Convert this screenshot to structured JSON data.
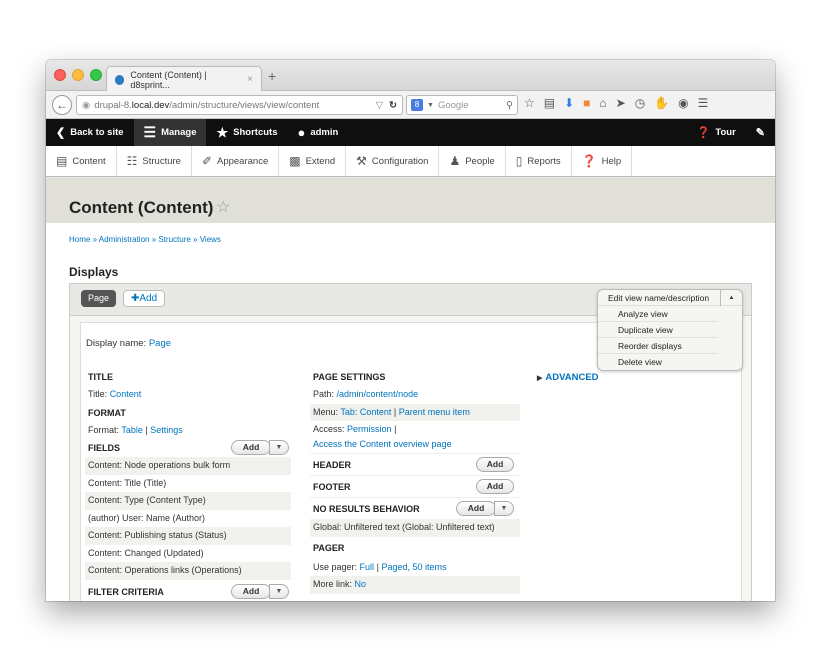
{
  "browser": {
    "tab_title": "Content (Content) | d8sprint...",
    "tab_close": "×",
    "new_tab": "+",
    "url_prefix": "drupal-8.",
    "url_host": "local.dev",
    "url_path": "/admin/structure/views/view/content",
    "search_placeholder": "Google"
  },
  "drupal_toolbar": {
    "back": "Back to site",
    "manage": "Manage",
    "shortcuts": "Shortcuts",
    "user": "admin",
    "tour": "Tour"
  },
  "tray": {
    "items": [
      "Content",
      "Structure",
      "Appearance",
      "Extend",
      "Configuration",
      "People",
      "Reports",
      "Help"
    ]
  },
  "page": {
    "title": "Content (Content)",
    "breadcrumb": "Home » Administration » Structure » Views",
    "displays_heading": "Displays"
  },
  "views": {
    "page_tab": "Page",
    "add_button": "✚Add",
    "display_name_label": "Display name:",
    "display_name_value": "Page",
    "dropdown": {
      "primary": "Edit view name/description",
      "items": [
        "Analyze view",
        "Duplicate view",
        "Reorder displays",
        "Delete view"
      ]
    },
    "col1": {
      "title_head": "TITLE",
      "title_label": "Title:",
      "title_value": "Content",
      "format_head": "FORMAT",
      "format_label": "Format:",
      "format_value": "Table",
      "format_sep": "|",
      "format_settings": "Settings",
      "fields_head": "FIELDS",
      "fields_add": "Add",
      "fields": [
        "Content: Node operations bulk form",
        "Content: Title (Title)",
        "Content: Type (Content Type)",
        "(author) User: Name (Author)",
        "Content: Publishing status (Status)",
        "Content: Changed (Updated)",
        "Content: Operations links (Operations)"
      ],
      "filter_head": "FILTER CRITERIA",
      "filter_add": "Add"
    },
    "col2": {
      "page_settings_head": "PAGE SETTINGS",
      "path_label": "Path:",
      "path_value": "/admin/content/node",
      "menu_label": "Menu:",
      "menu_value": "Tab: Content",
      "menu_sep": "|",
      "menu_parent": "Parent menu item",
      "access_label": "Access:",
      "access_value": "Permission",
      "access_sep": "|",
      "access_detail": "Access the Content overview page",
      "header_head": "HEADER",
      "header_add": "Add",
      "footer_head": "FOOTER",
      "footer_add": "Add",
      "nrb_head": "NO RESULTS BEHAVIOR",
      "nrb_add": "Add",
      "nrb_value": "Global: Unfiltered text (Global: Unfiltered text)",
      "pager_head": "PAGER",
      "pager_label": "Use pager:",
      "pager_value": "Full",
      "pager_sep": "|",
      "pager_detail": "Paged, 50 items",
      "more_label": "More link:",
      "more_value": "No"
    },
    "col3": {
      "advanced": "ADVANCED"
    }
  },
  "colors": {
    "link": "#0074bd",
    "toolbar_bg": "#0f0f0f",
    "header_bg": "#e0e0d8"
  }
}
